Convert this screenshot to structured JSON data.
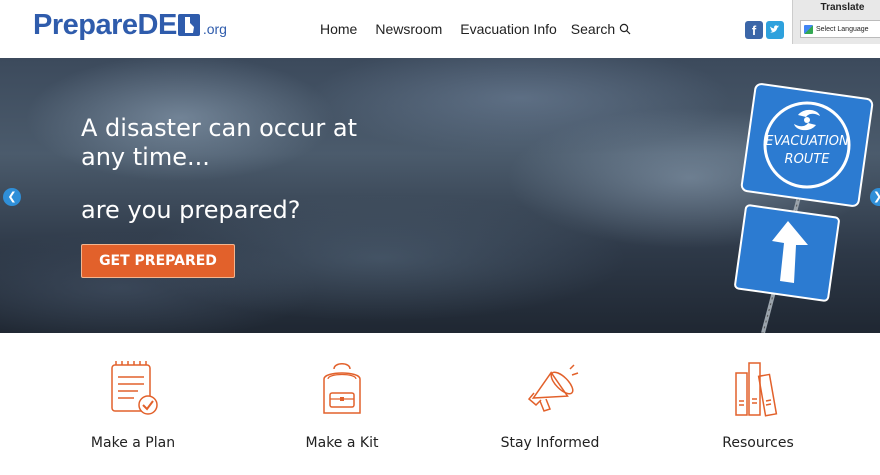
{
  "brand": {
    "logo_text": "PrepareDE",
    "logo_suffix": ".org",
    "color": "#2f5cac"
  },
  "nav": {
    "items": [
      "Home",
      "Newsroom",
      "Evacuation Info"
    ],
    "search_label": "Search",
    "search_icon": "search-icon"
  },
  "social": {
    "facebook_glyph": "f",
    "twitter_icon": "twitter-icon"
  },
  "translate": {
    "title": "Translate",
    "select_value": "Select Language"
  },
  "hero": {
    "line1": "A disaster can occur at any time...",
    "line2": "are you prepared?",
    "cta": "GET PREPARED",
    "sign_top": "EVACUATION",
    "sign_bottom": "ROUTE",
    "accent": "#e2612b",
    "arrow_color": "#2f8fd8"
  },
  "features": [
    {
      "label": "Make a Plan",
      "icon": "checklist-icon"
    },
    {
      "label": "Make a Kit",
      "icon": "backpack-icon"
    },
    {
      "label": "Stay Informed",
      "icon": "megaphone-icon"
    },
    {
      "label": "Resources",
      "icon": "books-icon"
    }
  ]
}
